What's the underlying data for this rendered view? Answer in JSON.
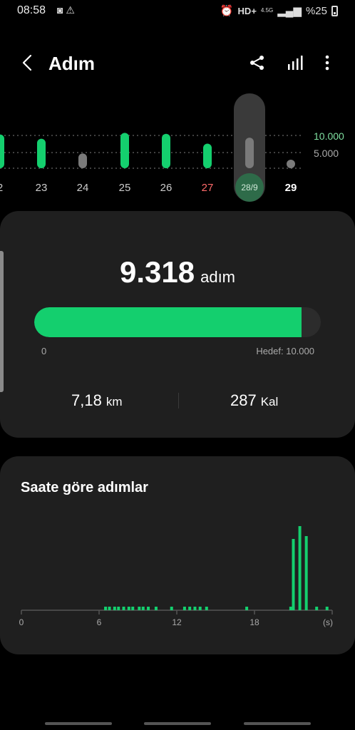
{
  "status_bar": {
    "time": "08:58",
    "left_icons": [
      "screenshot-icon",
      "warning-icon"
    ],
    "right_icons": [
      "alarm-icon",
      "hd-plus-icon",
      "mobile-data-icon",
      "signal-icon"
    ],
    "hd_label": "HD+",
    "network_label": "4.5G",
    "battery": "%25"
  },
  "app_bar": {
    "title": "Adım",
    "icons": [
      "back-icon",
      "share-icon",
      "bar-chart-icon",
      "more-vert-icon"
    ]
  },
  "week_chart": {
    "goal_lines": [
      "10.000",
      "5.000"
    ],
    "days": [
      {
        "label": "2",
        "steps": 10300,
        "met": true
      },
      {
        "label": "23",
        "steps": 9000,
        "met": true
      },
      {
        "label": "24",
        "steps": 4500,
        "met": false
      },
      {
        "label": "25",
        "steps": 10800,
        "met": true
      },
      {
        "label": "26",
        "steps": 10500,
        "met": true
      },
      {
        "label": "27",
        "steps": 7500,
        "met": true
      },
      {
        "label": "28/9",
        "steps": 9318,
        "met": false,
        "selected": true
      },
      {
        "label": "29",
        "steps": 0,
        "met": false
      }
    ],
    "colors": {
      "met": "#14cf6e",
      "unmet": "#7a7a7a",
      "weekend": "#ff6b6b"
    }
  },
  "summary": {
    "steps": "9.318",
    "steps_unit": "adım",
    "progress": 0.9318,
    "progress_min": "0",
    "goal_label": "Hedef: 10.000",
    "distance": "7,18",
    "distance_unit": "km",
    "calories": "287",
    "calories_unit": "Kal"
  },
  "hourly": {
    "title": "Saate göre adımlar",
    "x_ticks": [
      "0",
      "6",
      "12",
      "18",
      "(s)"
    ],
    "chart_data": {
      "type": "bar",
      "xlabel": "(s)",
      "x": [
        6.5,
        6.8,
        7.2,
        7.5,
        7.9,
        8.3,
        8.6,
        9.1,
        9.4,
        9.8,
        10.4,
        11.6,
        12.6,
        13.0,
        13.4,
        13.8,
        14.3,
        17.4,
        20.8,
        21.0,
        21.5,
        22.0,
        22.8,
        23.6
      ],
      "values": [
        3,
        3,
        3,
        3,
        3,
        3,
        3,
        3,
        3,
        3,
        3,
        3,
        3,
        3,
        3,
        3,
        3,
        3,
        3,
        100,
        118,
        104,
        3,
        3
      ],
      "xlim": [
        0,
        24
      ]
    }
  }
}
